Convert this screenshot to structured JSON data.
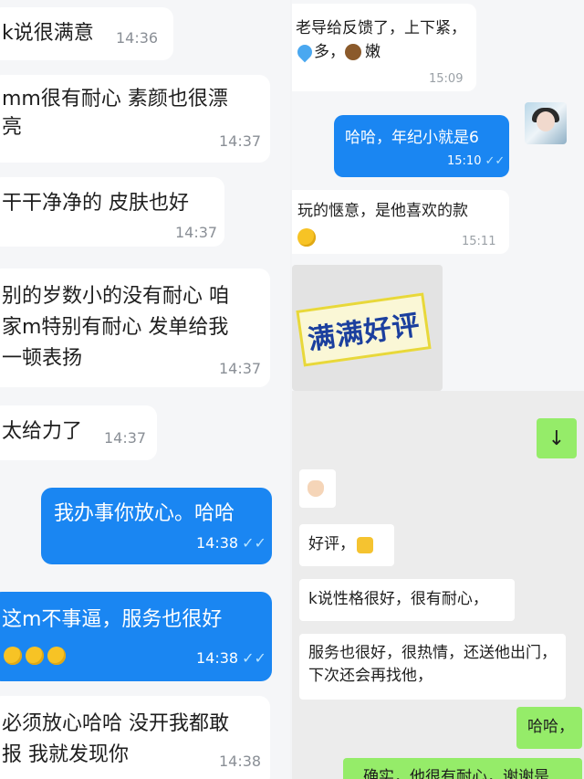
{
  "left_chat": {
    "messages": [
      {
        "text": "k说很满意",
        "time": "14:36"
      },
      {
        "text": "mm很有耐心 素颜也很漂亮",
        "time": "14:37"
      },
      {
        "text": "干干净净的 皮肤也好",
        "time": "14:37"
      },
      {
        "text": "别的岁数小的没有耐心 咱家m特别有耐心 发单给我一顿表扬",
        "time": "14:37"
      },
      {
        "text": "太给力了",
        "time": "14:37"
      },
      {
        "text": "我办事你放心。哈哈",
        "time": "14:38",
        "read": "✓✓"
      },
      {
        "text": "这m不事逼，服务也很好",
        "time": "14:38",
        "read": "✓✓",
        "emoji": [
          "slightly-smiling-face",
          "slightly-smiling-face",
          "rolling-laughing-face"
        ]
      },
      {
        "text": "必须放心哈哈 没开我都敢报 我就发现你",
        "time": "14:38"
      }
    ]
  },
  "right_top_chat": {
    "messages": [
      {
        "text": "老导给反馈了，上下紧，",
        "text_b": "多，",
        "text_c": "嫩",
        "time": "15:09",
        "icons": [
          "sweat-droplets-icon",
          "bear-face-icon"
        ]
      },
      {
        "text": "哈哈，年纪小就是6",
        "time": "15:10",
        "read": "✓✓"
      },
      {
        "text": "玩的惬意，是他喜欢的款",
        "time": "15:11",
        "icons": [
          "face-blowing-kiss-icon"
        ]
      }
    ],
    "sticker_text": "满满好评"
  },
  "right_bottom_chat": {
    "messages": [
      {
        "text": "↓"
      },
      {
        "text": "",
        "icons": [
          "ok-hand-icon"
        ]
      },
      {
        "text": "好评，",
        "icons": [
          "thumbs-up-icon"
        ]
      },
      {
        "text": "k说性格很好，很有耐心，"
      },
      {
        "text": "服务也很好，很热情，还送他出门，下次还会再找他，"
      },
      {
        "text": "哈哈，"
      },
      {
        "text": "确实，他很有耐心，谢谢是"
      }
    ]
  },
  "colors": {
    "blue_bubble": "#1a86f2",
    "green_bubble": "#95ec69",
    "white_bubble": "#ffffff"
  }
}
